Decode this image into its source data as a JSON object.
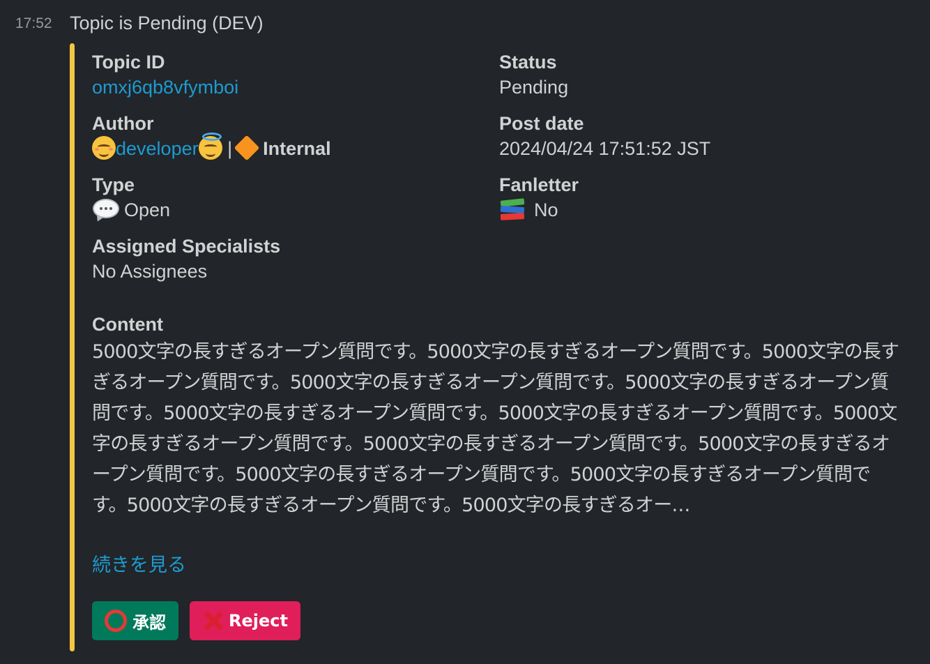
{
  "message": {
    "timestamp": "17:52",
    "title": "Topic is Pending (DEV)",
    "accent_color": "#f2c744"
  },
  "fields": {
    "topic_id": {
      "label": "Topic ID",
      "value": "omxj6qb8vfymboi"
    },
    "status": {
      "label": "Status",
      "value": "Pending"
    },
    "author": {
      "label": "Author",
      "prefix_icon": "relieved-face-emoji",
      "name": "developer",
      "suffix_icon": "halo-face-emoji",
      "separator": "|",
      "tag_icon": "orange-diamond-emoji",
      "tag": "Internal"
    },
    "post_date": {
      "label": "Post date",
      "value": "2024/04/24 17:51:52 JST"
    },
    "type": {
      "label": "Type",
      "icon": "speech-balloon-emoji",
      "value": "Open"
    },
    "fanletter": {
      "label": "Fanletter",
      "icon": "books-emoji",
      "value": "No"
    },
    "assigned": {
      "label": "Assigned Specialists",
      "value": "No Assignees"
    }
  },
  "content": {
    "label": "Content",
    "text": "5000文字の長すぎるオープン質問です。5000文字の長すぎるオープン質問です。5000文字の長すぎるオープン質問です。5000文字の長すぎるオープン質問です。5000文字の長すぎるオープン質問です。5000文字の長すぎるオープン質問です。5000文字の長すぎるオープン質問です。5000文字の長すぎるオープン質問です。5000文字の長すぎるオープン質問です。5000文字の長すぎるオープン質問です。5000文字の長すぎるオープン質問です。5000文字の長すぎるオープン質問です。5000文字の長すぎるオープン質問です。5000文字の長すぎるオー…",
    "see_more": "続きを見る"
  },
  "actions": {
    "approve": {
      "label": "承認",
      "icon": "hollow-red-circle-emoji",
      "color": "#007a5a"
    },
    "reject": {
      "label": "Reject",
      "icon": "cross-mark-emoji",
      "color": "#e01e5a"
    }
  },
  "colors": {
    "background": "#222529",
    "link": "#1d9bd1",
    "text": "#d1d2d3"
  }
}
